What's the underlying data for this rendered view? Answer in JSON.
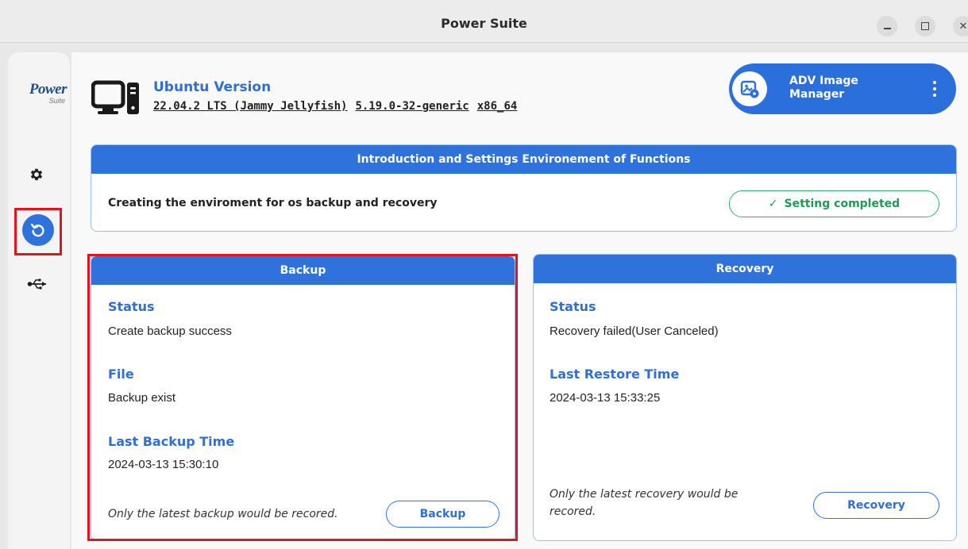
{
  "window": {
    "title": "Power Suite"
  },
  "logo": {
    "line1": "Power",
    "line2": "Suite"
  },
  "sidebar": {
    "items": [
      {
        "icon": "gear-icon",
        "label": "Settings"
      },
      {
        "icon": "restore-icon",
        "label": "Backup and Recovery",
        "active": true
      },
      {
        "icon": "usb-icon",
        "label": "USB"
      }
    ]
  },
  "os": {
    "title": "Ubuntu Version",
    "version": "22.04.2 LTS (Jammy Jellyfish)",
    "kernel": "5.19.0-32-generic",
    "arch": "x86_64"
  },
  "adv": {
    "label_line1": "ADV Image",
    "label_line2": "Manager"
  },
  "intro": {
    "header": "Introduction and Settings Environement of Functions",
    "description": "Creating the enviroment for os backup and recovery",
    "status": "Setting completed",
    "status_check": "✓"
  },
  "backup": {
    "header": "Backup",
    "status_label": "Status",
    "status_value": "Create backup success",
    "file_label": "File",
    "file_value": "Backup exist",
    "time_label": "Last Backup Time",
    "time_value": "2024-03-13 15:30:10",
    "note": "Only the latest backup would be recored.",
    "button": "Backup"
  },
  "recovery": {
    "header": "Recovery",
    "status_label": "Status",
    "status_value": "Recovery failed(User Canceled)",
    "time_label": "Last Restore Time",
    "time_value": "2024-03-13 15:33:25",
    "note_line1": "Only the latest recovery would be",
    "note_line2": "recored.",
    "button": "Recovery"
  },
  "colors": {
    "accent": "#2f72db",
    "success": "#2fae6b",
    "highlight": "#e0161d"
  }
}
